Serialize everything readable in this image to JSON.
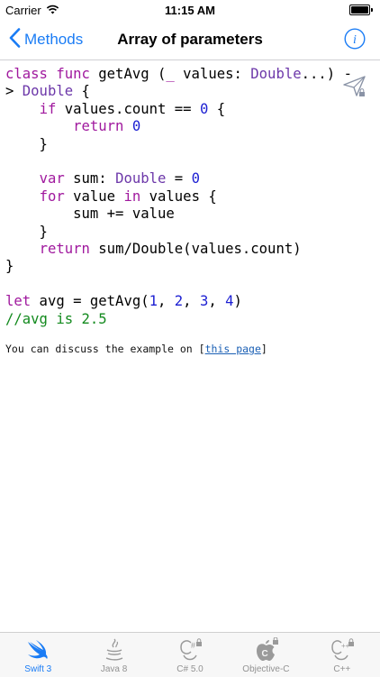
{
  "status_bar": {
    "carrier": "Carrier",
    "time": "11:15 AM"
  },
  "nav": {
    "back_label": "Methods",
    "title": "Array of parameters"
  },
  "code_lines": [
    [
      {
        "t": "class func ",
        "c": "kw"
      },
      {
        "t": "getAvg (",
        "c": ""
      },
      {
        "t": "_",
        "c": "kw"
      },
      {
        "t": " values: ",
        "c": ""
      },
      {
        "t": "Double",
        "c": "ty"
      },
      {
        "t": "...) -",
        "c": ""
      }
    ],
    [
      {
        "t": "> ",
        "c": ""
      },
      {
        "t": "Double",
        "c": "ty"
      },
      {
        "t": " {",
        "c": ""
      }
    ],
    [
      {
        "t": "    ",
        "c": ""
      },
      {
        "t": "if",
        "c": "kw"
      },
      {
        "t": " values.count == ",
        "c": ""
      },
      {
        "t": "0",
        "c": "nm"
      },
      {
        "t": " {",
        "c": ""
      }
    ],
    [
      {
        "t": "        ",
        "c": ""
      },
      {
        "t": "return",
        "c": "kw"
      },
      {
        "t": " ",
        "c": ""
      },
      {
        "t": "0",
        "c": "nm"
      }
    ],
    [
      {
        "t": "    }",
        "c": ""
      }
    ],
    [],
    [
      {
        "t": "    ",
        "c": ""
      },
      {
        "t": "var",
        "c": "kw"
      },
      {
        "t": " sum: ",
        "c": ""
      },
      {
        "t": "Double",
        "c": "ty"
      },
      {
        "t": " = ",
        "c": ""
      },
      {
        "t": "0",
        "c": "nm"
      }
    ],
    [
      {
        "t": "    ",
        "c": ""
      },
      {
        "t": "for",
        "c": "kw"
      },
      {
        "t": " value ",
        "c": ""
      },
      {
        "t": "in",
        "c": "kw"
      },
      {
        "t": " values {",
        "c": ""
      }
    ],
    [
      {
        "t": "        sum += value",
        "c": ""
      }
    ],
    [
      {
        "t": "    }",
        "c": ""
      }
    ],
    [
      {
        "t": "    ",
        "c": ""
      },
      {
        "t": "return",
        "c": "kw"
      },
      {
        "t": " sum/Double(values.count)",
        "c": ""
      }
    ],
    [
      {
        "t": "}",
        "c": ""
      }
    ],
    [],
    [
      {
        "t": "let",
        "c": "kw"
      },
      {
        "t": " avg = getAvg(",
        "c": ""
      },
      {
        "t": "1",
        "c": "nm"
      },
      {
        "t": ", ",
        "c": ""
      },
      {
        "t": "2",
        "c": "nm"
      },
      {
        "t": ", ",
        "c": ""
      },
      {
        "t": "3",
        "c": "nm"
      },
      {
        "t": ", ",
        "c": ""
      },
      {
        "t": "4",
        "c": "nm"
      },
      {
        "t": ")",
        "c": ""
      }
    ],
    [
      {
        "t": "//avg is 2.5",
        "c": "cm"
      }
    ]
  ],
  "discuss": {
    "prefix": "You can discuss the example on ",
    "link_open": "[",
    "link_text": "this page",
    "link_close": "]"
  },
  "tabs": [
    {
      "label": "Swift 3",
      "icon": "swift-icon",
      "active": true
    },
    {
      "label": "Java 8",
      "icon": "java-icon",
      "active": false
    },
    {
      "label": "C# 5.0",
      "icon": "csharp-icon",
      "active": false
    },
    {
      "label": "Objective-C",
      "icon": "apple-icon",
      "active": false
    },
    {
      "label": "C++",
      "icon": "cpp-icon",
      "active": false
    }
  ],
  "colors": {
    "accent": "#1a7cf5",
    "keyword": "#a0199e",
    "type": "#6c37a9",
    "number": "#1b1ed2",
    "comment": "#138a1e"
  }
}
